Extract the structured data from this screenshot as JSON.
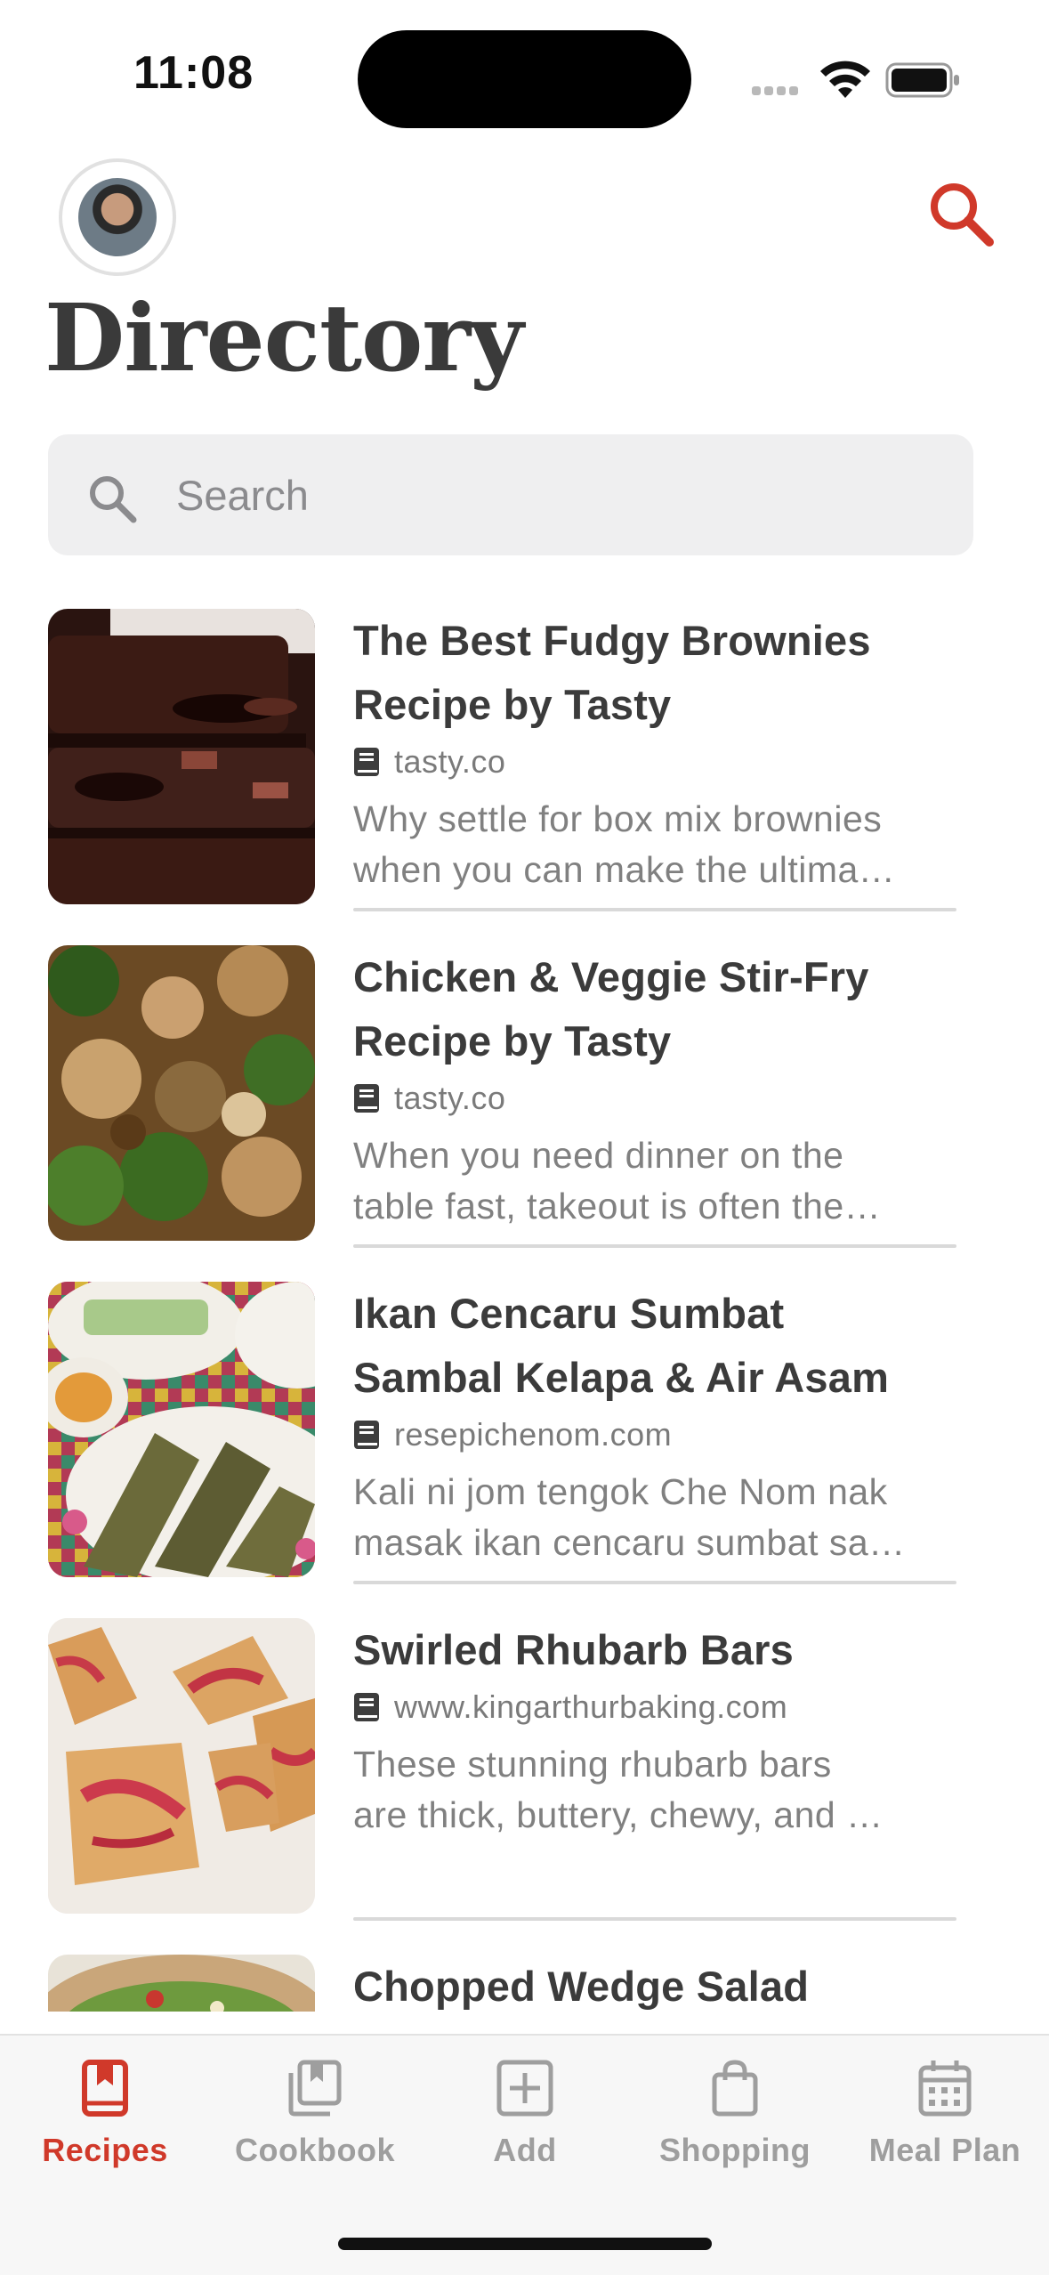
{
  "status_bar": {
    "time": "11:08"
  },
  "header": {
    "title": "Directory"
  },
  "search": {
    "placeholder": "Search"
  },
  "recipes": [
    {
      "title_lines": [
        "The Best Fudgy Brownies",
        "Recipe by Tasty"
      ],
      "source": "tasty.co",
      "description_lines": [
        "Why settle for box mix brownies",
        "when you can make the ultima…"
      ]
    },
    {
      "title_lines": [
        "Chicken & Veggie Stir-Fry",
        "Recipe by Tasty"
      ],
      "source": "tasty.co",
      "description_lines": [
        "When you need dinner on the",
        "table fast, takeout is often the…"
      ]
    },
    {
      "title_lines": [
        "Ikan Cencaru Sumbat",
        "Sambal Kelapa & Air Asam"
      ],
      "source": "resepichenom.com",
      "description_lines": [
        "Kali ni jom tengok Che Nom nak",
        "masak ikan cencaru sumbat sa…"
      ]
    },
    {
      "title_lines": [
        "Swirled Rhubarb Bars"
      ],
      "source": "www.kingarthurbaking.com",
      "description_lines": [
        "These stunning rhubarb bars",
        "are thick, buttery, chewy, and …"
      ]
    },
    {
      "title_lines": [
        "Chopped Wedge Salad"
      ],
      "source": "",
      "description_lines": []
    }
  ],
  "tabs": [
    {
      "label": "Recipes",
      "icon": "bookmark-book-icon",
      "active": true
    },
    {
      "label": "Cookbook",
      "icon": "cookbook-icon",
      "active": false
    },
    {
      "label": "Add",
      "icon": "add-square-icon",
      "active": false
    },
    {
      "label": "Shopping",
      "icon": "shopping-bag-icon",
      "active": false
    },
    {
      "label": "Meal Plan",
      "icon": "calendar-icon",
      "active": false
    }
  ],
  "colors": {
    "accent": "#d0392a",
    "inactive": "#9e9e9e",
    "search_bg": "#efeff0"
  }
}
